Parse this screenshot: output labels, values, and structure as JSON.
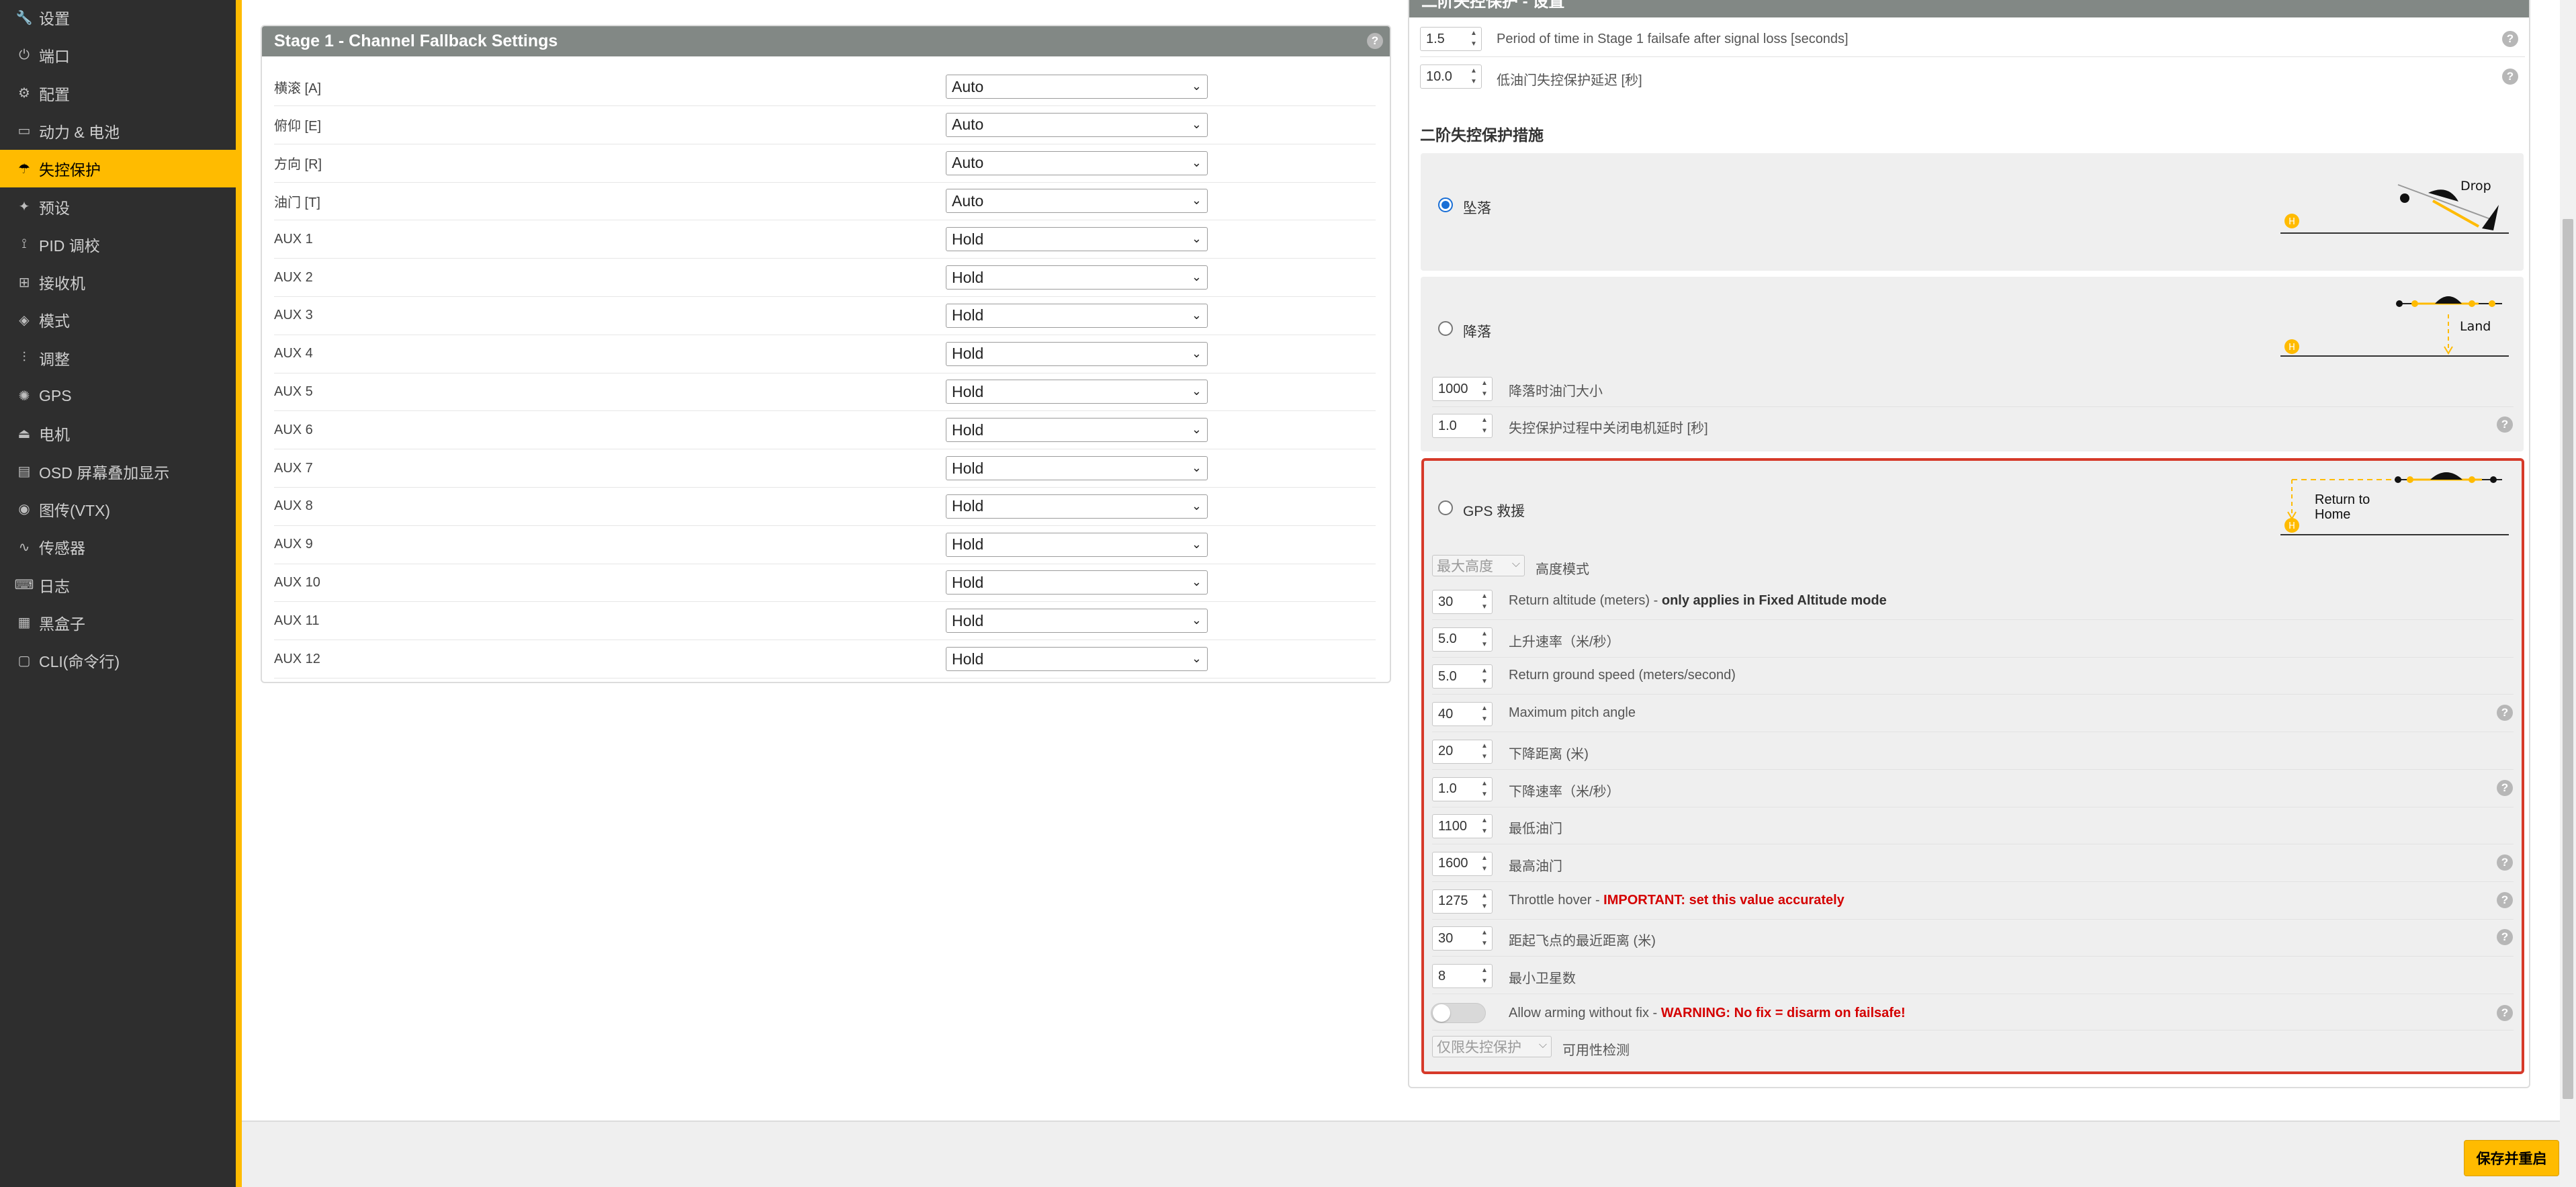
{
  "sidebar": {
    "items": [
      {
        "label": "设置",
        "icon": "wrench-icon"
      },
      {
        "label": "端口",
        "icon": "plug-icon"
      },
      {
        "label": "配置",
        "icon": "gear-icon"
      },
      {
        "label": "动力 & 电池",
        "icon": "battery-icon"
      },
      {
        "label": "失控保护",
        "icon": "parachute-icon"
      },
      {
        "label": "预设",
        "icon": "magic-icon"
      },
      {
        "label": "PID 调校",
        "icon": "pid-icon"
      },
      {
        "label": "接收机",
        "icon": "receiver-icon"
      },
      {
        "label": "模式",
        "icon": "modes-icon"
      },
      {
        "label": "调整",
        "icon": "sliders-icon"
      },
      {
        "label": "GPS",
        "icon": "satellite-icon"
      },
      {
        "label": "电机",
        "icon": "motor-icon"
      },
      {
        "label": "OSD 屏幕叠加显示",
        "icon": "osd-icon"
      },
      {
        "label": "图传(VTX)",
        "icon": "broadcast-icon"
      },
      {
        "label": "传感器",
        "icon": "pulse-icon"
      },
      {
        "label": "日志",
        "icon": "keyboard-icon"
      },
      {
        "label": "黑盒子",
        "icon": "blackbox-icon"
      },
      {
        "label": "CLI(命令行)",
        "icon": "terminal-icon"
      }
    ],
    "active_index": 4,
    "accent": "#ffbb00"
  },
  "stage1": {
    "title": "Stage 1 - Channel Fallback Settings",
    "channels": [
      {
        "label": "横滚 [A]",
        "value": "Auto"
      },
      {
        "label": "俯仰 [E]",
        "value": "Auto"
      },
      {
        "label": "方向 [R]",
        "value": "Auto"
      },
      {
        "label": "油门 [T]",
        "value": "Auto"
      },
      {
        "label": "AUX 1",
        "value": "Hold"
      },
      {
        "label": "AUX 2",
        "value": "Hold"
      },
      {
        "label": "AUX 3",
        "value": "Hold"
      },
      {
        "label": "AUX 4",
        "value": "Hold"
      },
      {
        "label": "AUX 5",
        "value": "Hold"
      },
      {
        "label": "AUX 6",
        "value": "Hold"
      },
      {
        "label": "AUX 7",
        "value": "Hold"
      },
      {
        "label": "AUX 8",
        "value": "Hold"
      },
      {
        "label": "AUX 9",
        "value": "Hold"
      },
      {
        "label": "AUX 10",
        "value": "Hold"
      },
      {
        "label": "AUX 11",
        "value": "Hold"
      },
      {
        "label": "AUX 12",
        "value": "Hold"
      }
    ]
  },
  "stage2": {
    "header": "二阶失控保护 - 设置",
    "top_settings": [
      {
        "value": "1.5",
        "label": "Period of time in Stage 1 failsafe after signal loss [seconds]"
      },
      {
        "value": "10.0",
        "label": "低油门失控保护延迟 [秒]"
      }
    ],
    "procedure_title": "二阶失控保护措施",
    "drop": {
      "label": "坠落",
      "diagram_text": "Drop"
    },
    "land": {
      "label": "降落",
      "diagram_text": "Land",
      "settings": [
        {
          "value": "1000",
          "label": "降落时油门大小"
        },
        {
          "value": "1.0",
          "label": "失控保护过程中关闭电机延时 [秒]"
        }
      ]
    },
    "gps_rescue": {
      "label": "GPS 救援",
      "diagram_text_1": "Return to",
      "diagram_text_2": "Home",
      "altitude_mode": {
        "value": "最大高度",
        "label": "高度模式"
      },
      "settings": [
        {
          "value": "30",
          "label": "Return altitude (meters) - ",
          "bold": "only applies in Fixed Altitude mode"
        },
        {
          "value": "5.0",
          "label": "上升速率（米/秒）"
        },
        {
          "value": "5.0",
          "label": "Return ground speed (meters/second)"
        },
        {
          "value": "40",
          "label": "Maximum pitch angle"
        },
        {
          "value": "20",
          "label": "下降距离 (米)"
        },
        {
          "value": "1.0",
          "label": "下降速率（米/秒）"
        },
        {
          "value": "1100",
          "label": "最低油门"
        },
        {
          "value": "1600",
          "label": "最高油门"
        },
        {
          "value": "1275",
          "label": "Throttle hover - ",
          "warn": "IMPORTANT: set this value accurately"
        },
        {
          "value": "30",
          "label": "距起飞点的最近距离 (米)"
        },
        {
          "value": "8",
          "label": "最小卫星数"
        }
      ],
      "arming": {
        "label": "Allow arming without fix - ",
        "warn": "WARNING: No fix = disarm on failsafe!"
      },
      "sanity": {
        "value": "仅限失控保护",
        "label": "可用性检测"
      },
      "highlight_color": "#d63a2a"
    }
  },
  "save_button": "保存并重启"
}
